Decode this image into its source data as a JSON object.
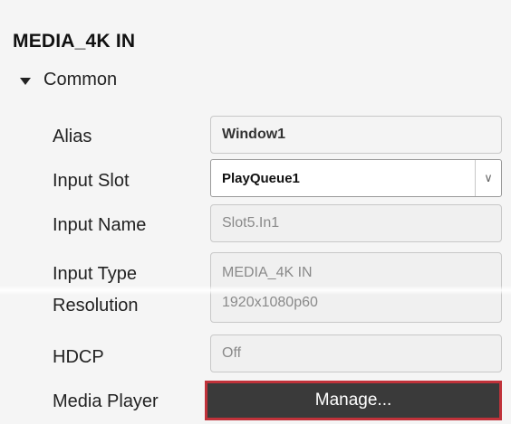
{
  "panel": {
    "title": "MEDIA_4K IN",
    "section_label": "Common",
    "section_icon": "triangle-down-icon"
  },
  "fields": {
    "alias": {
      "label": "Alias",
      "value": "Window1"
    },
    "input_slot": {
      "label": "Input Slot",
      "value": "PlayQueue1"
    },
    "input_name": {
      "label": "Input Name",
      "value": "Slot5.In1"
    },
    "input_type": {
      "label": "Input Type",
      "value": "MEDIA_4K IN"
    },
    "resolution": {
      "label": "Resolution",
      "value": "1920x1080p60"
    },
    "hdcp": {
      "label": "HDCP",
      "value": "Off"
    },
    "media_player": {
      "label": "Media Player",
      "button": "Manage..."
    }
  },
  "colors": {
    "background": "#f5f5f5",
    "button_bg": "#3a3a3a",
    "highlight_border": "#c0323a"
  }
}
